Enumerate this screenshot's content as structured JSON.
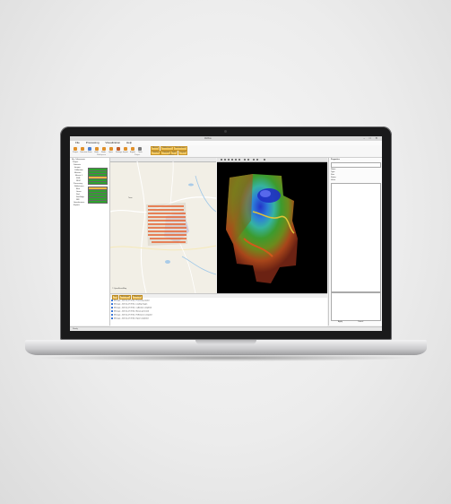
{
  "app": {
    "title": "Ortho"
  },
  "menu": {
    "items": [
      "File",
      "Processing",
      "Visualization",
      "Help"
    ]
  },
  "ribbon": {
    "buttons": [
      "Project",
      "Overview",
      "Save",
      "Undo",
      "Redo",
      "Open",
      "Settings",
      "Import",
      "Export",
      "Tools"
    ],
    "highlighted": [
      "Mosaic",
      "Reflectance",
      "Georeference",
      "Overlay",
      "Compare",
      "Split",
      "Layout"
    ],
    "groups": [
      "Workspace",
      "Project",
      "Mosaic"
    ]
  },
  "tree": {
    "rows": [
      {
        "label": "My_Orthomosaic",
        "bar": null
      },
      {
        "label": "Project",
        "bar": null
      },
      {
        "label": "Datasets",
        "bar": null
      },
      {
        "label": "Images",
        "bar": "green"
      },
      {
        "label": "Calibration",
        "bar": "green"
      },
      {
        "label": "Mosaics",
        "bar": "green"
      },
      {
        "label": "Mosaic 1",
        "bar": "orange"
      },
      {
        "label": "RGB",
        "bar": "green"
      },
      {
        "label": "NDVI",
        "bar": "green"
      },
      {
        "label": "Processing",
        "bar": null
      },
      {
        "label": "Reflectance",
        "bar": "orange"
      },
      {
        "label": "Blue",
        "bar": "green"
      },
      {
        "label": "Green",
        "bar": "green"
      },
      {
        "label": "Red",
        "bar": "green"
      },
      {
        "label": "Red Edge",
        "bar": "green"
      },
      {
        "label": "NIR",
        "bar": "green"
      },
      {
        "label": "Georeference",
        "bar": null
      },
      {
        "label": "Exports",
        "bar": null
      }
    ]
  },
  "map": {
    "attribution": "© OpenStreetMap",
    "town": "Town"
  },
  "right_panel": {
    "title": "Properties",
    "fields": [
      "Name",
      "Type",
      "Size",
      "Status",
      "Value"
    ],
    "footer_buttons": [
      "Apply",
      "Cancel"
    ]
  },
  "log": {
    "tabs": [
      "Log",
      "Messages",
      "Warnings"
    ],
    "rows": [
      "Message - 2017-11-27 09:42 - Processing started",
      "Message - 2017-11-27 09:42 - Loading images",
      "Message - 2017-11-27 09:43 - Calibration completed",
      "Message - 2017-11-27 09:44 - Mosaic generated",
      "Message - 2017-11-27 09:45 - Reflectance computed",
      "Message - 2017-11-27 09:46 - Export completed"
    ]
  },
  "status": {
    "text": "Ready"
  }
}
